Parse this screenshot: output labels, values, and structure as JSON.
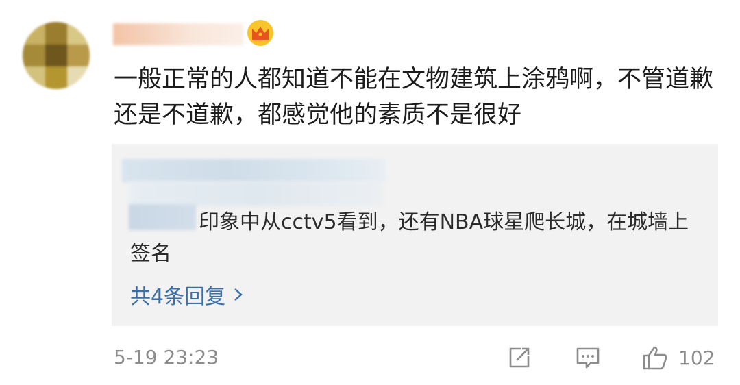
{
  "comment": {
    "text": "一般正常的人都知道不能在文物建筑上涂鸦啊，不管道歉还是不道歉，都感觉他的素质不是很好"
  },
  "reply": {
    "text": "印象中从cctv5看到，还有NBA球星爬长城，在城墙上签名",
    "more_label": "共4条回复"
  },
  "footer": {
    "timestamp": "5-19 23:23",
    "like_count": "102"
  },
  "icons": {
    "crown": "crown-icon",
    "share": "share-icon",
    "comment": "comment-icon",
    "like": "thumbs-up-icon",
    "chevron": "chevron-right-icon"
  },
  "colors": {
    "link": "#3a6fa8",
    "meta": "#8c8c8c",
    "reply_bg": "#f2f2f2"
  }
}
